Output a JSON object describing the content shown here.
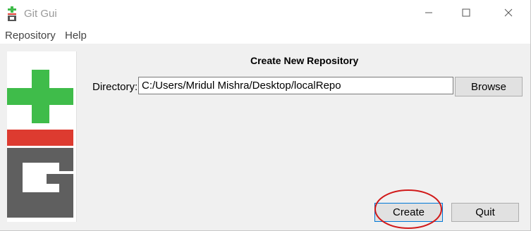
{
  "window": {
    "title": "Git Gui",
    "app_icon": "git-gui-icon",
    "controls": [
      "minimize-icon",
      "maximize-icon",
      "close-icon"
    ]
  },
  "menubar": {
    "items": [
      {
        "label": "Repository"
      },
      {
        "label": "Help"
      }
    ]
  },
  "dialog": {
    "title": "Create New Repository",
    "directory_label": "Directory:",
    "directory_value": "C:/Users/Mridul Mishra/Desktop/localRepo",
    "browse_label": "Browse",
    "create_label": "Create",
    "quit_label": "Quit"
  },
  "logo": {
    "name": "git-logo",
    "colors": {
      "plus": "#3fbc4a",
      "bar": "#dd3b30",
      "letters": "#5f5f5f"
    }
  },
  "annotation": {
    "highlight_target": "create-button",
    "color": "#d11a1a"
  },
  "colors": {
    "focus_border": "#0078d7",
    "window_bg": "#f0f0f0"
  }
}
